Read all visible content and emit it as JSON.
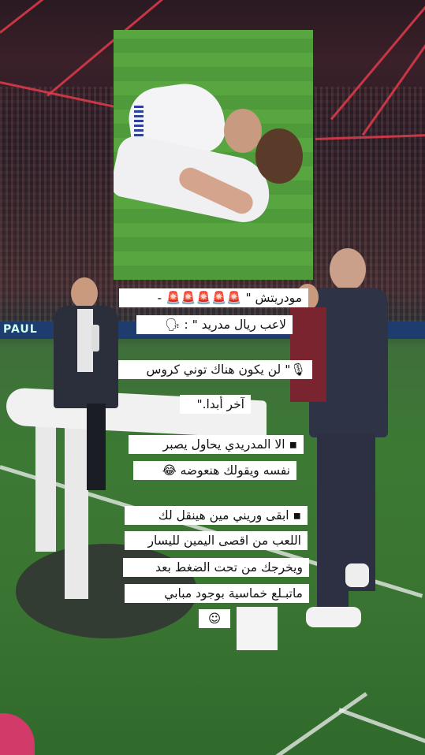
{
  "photo": {
    "description_icon": "players-hugging-photo"
  },
  "adboard": {
    "text": "PAUL"
  },
  "captions": {
    "line1": "مودريتش \" 🚨🚨🚨🚨🚨 -",
    "line2": "لاعب ريال مدريد \" : 🗣",
    "line3": "🎙\" لن يكون هناك توني كروس",
    "line4": "آخر أبدا.\"",
    "line5": "▪ الا المدريدي يحاول يصبر",
    "line6": "نفسه ويقولك هنعوضه 😂",
    "line7": "▪ ابقى وريني مين هينقل لك",
    "line8": "اللعب من اقصى اليمين لليسار",
    "line9": "ويخرجك من تحت الضغط بعد",
    "line10": "ماتبـلع خماسية بوجود مبابي",
    "line11": "☺"
  }
}
